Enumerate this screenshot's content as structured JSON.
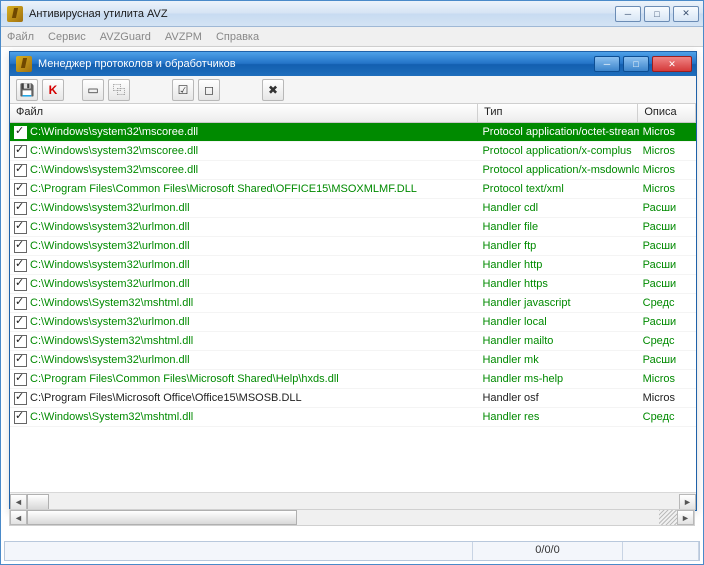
{
  "mainWindow": {
    "title": "Антивирусная утилита AVZ"
  },
  "menu": {
    "file": "Файл",
    "service": "Сервис",
    "avzguard": "AVZGuard",
    "avzpm": "AVZPM",
    "help": "Справка"
  },
  "childWindow": {
    "title": "Менеджер протоколов и обработчиков"
  },
  "toolbar": {
    "save": "save",
    "kav": "K",
    "doc": "doc",
    "copy": "copy",
    "check": "check",
    "uncheck": "uncheck",
    "delete": "delete"
  },
  "columns": {
    "file": "Файл",
    "type": "Тип",
    "desc": "Описа"
  },
  "rows": [
    {
      "file": "C:\\Windows\\system32\\mscoree.dll",
      "type": "Protocol application/octet-stream",
      "desc": "Micros",
      "selected": true
    },
    {
      "file": "C:\\Windows\\system32\\mscoree.dll",
      "type": "Protocol application/x-complus",
      "desc": "Micros"
    },
    {
      "file": "C:\\Windows\\system32\\mscoree.dll",
      "type": "Protocol application/x-msdownload",
      "desc": "Micros"
    },
    {
      "file": "C:\\Program Files\\Common Files\\Microsoft Shared\\OFFICE15\\MSOXMLMF.DLL",
      "type": "Protocol text/xml",
      "desc": "Micros"
    },
    {
      "file": "C:\\Windows\\system32\\urlmon.dll",
      "type": "Handler cdl",
      "desc": "Расши"
    },
    {
      "file": "C:\\Windows\\system32\\urlmon.dll",
      "type": "Handler file",
      "desc": "Расши"
    },
    {
      "file": "C:\\Windows\\system32\\urlmon.dll",
      "type": "Handler ftp",
      "desc": "Расши"
    },
    {
      "file": "C:\\Windows\\system32\\urlmon.dll",
      "type": "Handler http",
      "desc": "Расши"
    },
    {
      "file": "C:\\Windows\\system32\\urlmon.dll",
      "type": "Handler https",
      "desc": "Расши"
    },
    {
      "file": "C:\\Windows\\System32\\mshtml.dll",
      "type": "Handler javascript",
      "desc": "Средс"
    },
    {
      "file": "C:\\Windows\\system32\\urlmon.dll",
      "type": "Handler local",
      "desc": "Расши"
    },
    {
      "file": "C:\\Windows\\System32\\mshtml.dll",
      "type": "Handler mailto",
      "desc": "Средс"
    },
    {
      "file": "C:\\Windows\\system32\\urlmon.dll",
      "type": "Handler mk",
      "desc": "Расши"
    },
    {
      "file": "C:\\Program Files\\Common Files\\Microsoft Shared\\Help\\hxds.dll",
      "type": "Handler ms-help",
      "desc": "Micros"
    },
    {
      "file": "C:\\Program Files\\Microsoft Office\\Office15\\MSOSB.DLL",
      "type": "Handler osf",
      "desc": "Micros",
      "neutral": true
    },
    {
      "file": "C:\\Windows\\System32\\mshtml.dll",
      "type": "Handler res",
      "desc": "Средс"
    }
  ],
  "status": {
    "counter": "0/0/0"
  }
}
